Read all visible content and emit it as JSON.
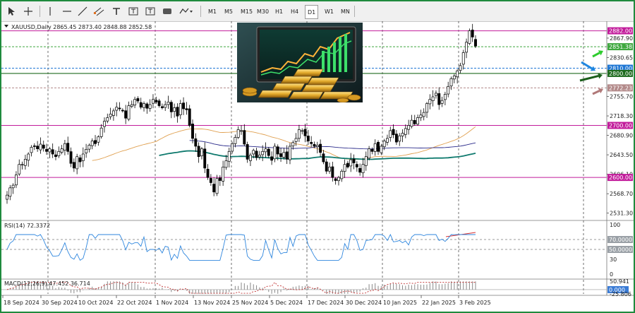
{
  "toolbar": {
    "timeframes": [
      "M1",
      "M5",
      "M15",
      "M30",
      "H1",
      "H4",
      "D1",
      "W1",
      "MN"
    ],
    "active_timeframe": "D1",
    "tools": [
      "cursor-tool",
      "crosshair-tool",
      "vertical-line-tool",
      "horizontal-line-tool",
      "trendline-tool",
      "channel-tool",
      "text-tool",
      "label-tool",
      "shapes-tool",
      "more-tools"
    ]
  },
  "main_chart": {
    "header": "XAUUSD,Daily  2865.45 2873.40 2848.88 2852.58",
    "price_axis_labels": [
      "2867.90",
      "2830.65",
      "2755.70",
      "2718.30",
      "2680.90",
      "2643.50",
      "2606.10",
      "2568.70",
      "2531.30"
    ],
    "price_tags": [
      {
        "label": "2882.00",
        "color": "#c21c9b"
      },
      {
        "label": "2851.38",
        "color": "#3fa83f"
      },
      {
        "label": "2810.00",
        "color": "#1f77d4"
      },
      {
        "label": "2800.00",
        "color": "#1f6b1f"
      },
      {
        "label": "2772.23",
        "color": "#b38a8a"
      },
      {
        "label": "2700.00",
        "color": "#c21c9b"
      },
      {
        "label": "2600.00",
        "color": "#c21c9b"
      }
    ],
    "arrow_colors": [
      "#2ecc2e",
      "#1f86e0",
      "#1a5e1a",
      "#b07878"
    ]
  },
  "rsi_panel": {
    "label": "RSI(14) 72.3372",
    "axis_labels": [
      "100",
      "70.0000",
      "50.0000",
      "30",
      "0"
    ]
  },
  "macd_panel": {
    "label": "MACD(12,26,9) 47.452 36.714",
    "axis_labels": [
      "50.941",
      "0.000",
      "-25.806"
    ]
  },
  "time_axis": [
    "18 Sep 2024",
    "30 Sep 2024",
    "10 Oct 2024",
    "22 Oct 2024",
    "1 Nov 2024",
    "13 Nov 2024",
    "25 Nov 2024",
    "5 Dec 2024",
    "17 Dec 2024",
    "30 Dec 2024",
    "10 Jan 2025",
    "22 Jan 2025",
    "3 Feb 2025"
  ],
  "chart_data": {
    "type": "candlestick",
    "symbol": "XAUUSD",
    "timeframe": "Daily",
    "ohlc_last": {
      "open": 2865.45,
      "high": 2873.4,
      "low": 2848.88,
      "close": 2852.58
    },
    "ylim": [
      2520,
      2895
    ],
    "horizontal_levels": [
      2882.0,
      2851.38,
      2810.0,
      2800.0,
      2772.23,
      2700.0,
      2600.0
    ],
    "closes": [
      2566,
      2580,
      2585,
      2605,
      2625,
      2625,
      2635,
      2645,
      2658,
      2660,
      2655,
      2664,
      2656,
      2650,
      2655,
      2645,
      2640,
      2650,
      2655,
      2665,
      2650,
      2627,
      2618,
      2640,
      2630,
      2645,
      2654,
      2662,
      2670,
      2665,
      2678,
      2695,
      2708,
      2715,
      2722,
      2728,
      2735,
      2732,
      2728,
      2714,
      2738,
      2740,
      2750,
      2747,
      2735,
      2742,
      2733,
      2740,
      2750,
      2745,
      2738,
      2734,
      2740,
      2745,
      2726,
      2734,
      2718,
      2742,
      2732,
      2730,
      2700,
      2675,
      2660,
      2640,
      2655,
      2618,
      2600,
      2590,
      2572,
      2598,
      2594,
      2620,
      2632,
      2650,
      2665,
      2677,
      2692,
      2690,
      2664,
      2635,
      2643,
      2652,
      2638,
      2643,
      2650,
      2655,
      2642,
      2633,
      2660,
      2645,
      2640,
      2648,
      2635,
      2660,
      2667,
      2675,
      2692,
      2690,
      2680,
      2670,
      2665,
      2660,
      2662,
      2648,
      2630,
      2612,
      2620,
      2600,
      2594,
      2600,
      2612,
      2625,
      2620,
      2634,
      2628,
      2620,
      2610,
      2625,
      2640,
      2655,
      2650,
      2665,
      2650,
      2660,
      2670,
      2675,
      2690,
      2682,
      2668,
      2680,
      2685,
      2694,
      2700,
      2710,
      2703,
      2715,
      2720,
      2725,
      2742,
      2750,
      2755,
      2762,
      2740,
      2748,
      2760,
      2775,
      2790,
      2795,
      2805,
      2815,
      2840,
      2860,
      2882,
      2870,
      2852.58
    ],
    "rsi": {
      "period": 14,
      "last": 72.3372,
      "levels": [
        70,
        50
      ],
      "range": [
        0,
        100
      ]
    },
    "macd": {
      "fast": 12,
      "slow": 26,
      "signal": 9,
      "main": 47.452,
      "signal_value": 36.714,
      "range": [
        -25.806,
        50.941
      ]
    }
  }
}
